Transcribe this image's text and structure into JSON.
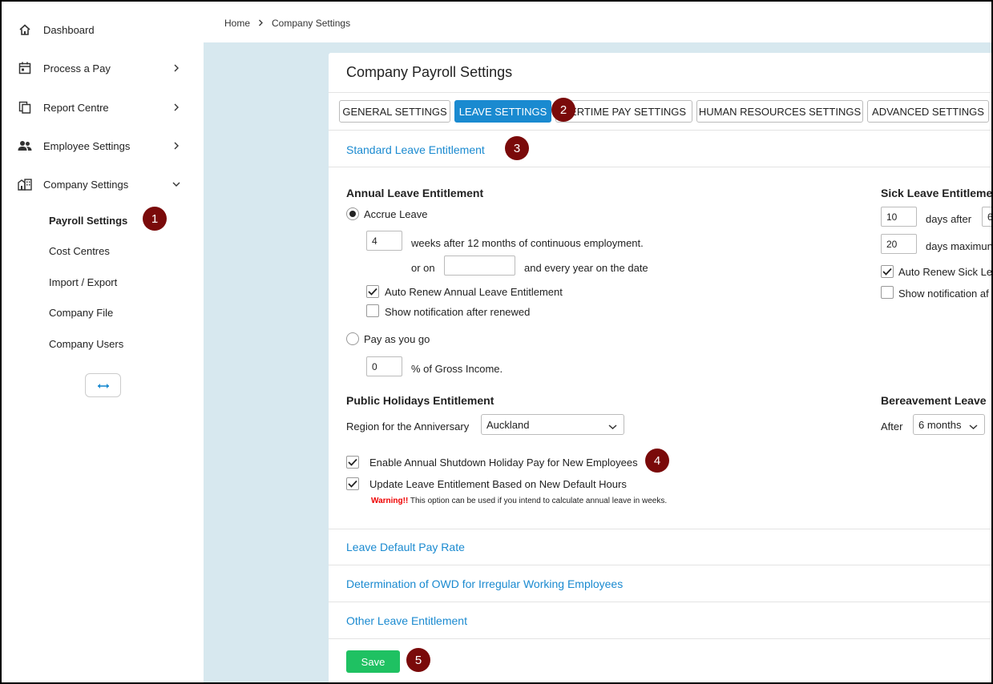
{
  "sidebar": {
    "items": [
      {
        "label": "Dashboard",
        "icon": "home-icon"
      },
      {
        "label": "Process a Pay",
        "icon": "calendar-icon"
      },
      {
        "label": "Report Centre",
        "icon": "documents-icon"
      },
      {
        "label": "Employee Settings",
        "icon": "people-icon"
      },
      {
        "label": "Company Settings",
        "icon": "building-icon"
      }
    ],
    "sub_items": [
      {
        "label": "Payroll Settings"
      },
      {
        "label": "Cost Centres"
      },
      {
        "label": "Import / Export"
      },
      {
        "label": "Company File"
      },
      {
        "label": "Company Users"
      }
    ],
    "collapse_icon": "double-arrow-icon"
  },
  "breadcrumb": {
    "home": "Home",
    "current": "Company Settings"
  },
  "page": {
    "title": "Company Payroll Settings"
  },
  "tabs": [
    {
      "label": "GENERAL SETTINGS"
    },
    {
      "label": "LEAVE SETTINGS"
    },
    {
      "label": "ERTIME PAY SETTINGS"
    },
    {
      "label": "HUMAN RESOURCES SETTINGS"
    },
    {
      "label": "ADVANCED SETTINGS"
    }
  ],
  "sections": {
    "standard": "Standard Leave Entitlement",
    "default_pay_rate": "Leave Default Pay Rate",
    "owd": "Determination of OWD for Irregular Working Employees",
    "other": "Other Leave Entitlement"
  },
  "annual": {
    "heading": "Annual Leave Entitlement",
    "accrue_label": "Accrue Leave",
    "weeks_value": "4",
    "weeks_text": "weeks after 12 months of continuous employment.",
    "or_on": "or on",
    "date_value": "",
    "every_year": "and every year on the date",
    "auto_renew": "Auto Renew Annual Leave Entitlement",
    "show_notification": "Show notification after renewed",
    "payg_label": "Pay as you go",
    "percent_value": "0",
    "percent_text": "% of Gross Income."
  },
  "sick": {
    "heading": "Sick Leave Entitleme",
    "days_value": "10",
    "days_after": "days after",
    "after_value": "6",
    "max_value": "20",
    "days_max": "days maximun",
    "auto_renew": "Auto Renew Sick Le",
    "show_notification": "Show notification af"
  },
  "public_holidays": {
    "heading": "Public Holidays Entitlement",
    "region_label": "Region for the Anniversary",
    "region_value": "Auckland"
  },
  "bereavement": {
    "heading": "Bereavement Leave",
    "after_label": "After",
    "after_value": "6 months"
  },
  "options": {
    "shutdown": "Enable Annual Shutdown Holiday Pay for New Employees",
    "update_entitlement": "Update Leave Entitlement Based on New Default Hours",
    "warning_label": "Warning!!",
    "warning_text": " This option can be used if you intend to calculate annual leave in weeks."
  },
  "save_label": "Save",
  "badges": [
    "1",
    "2",
    "3",
    "4",
    "5"
  ],
  "colors": {
    "accent": "#1a8ad0",
    "save": "#1fc162",
    "badge": "#7a0a0a",
    "warning": "#ee0000",
    "background": "#d7e8ef"
  }
}
